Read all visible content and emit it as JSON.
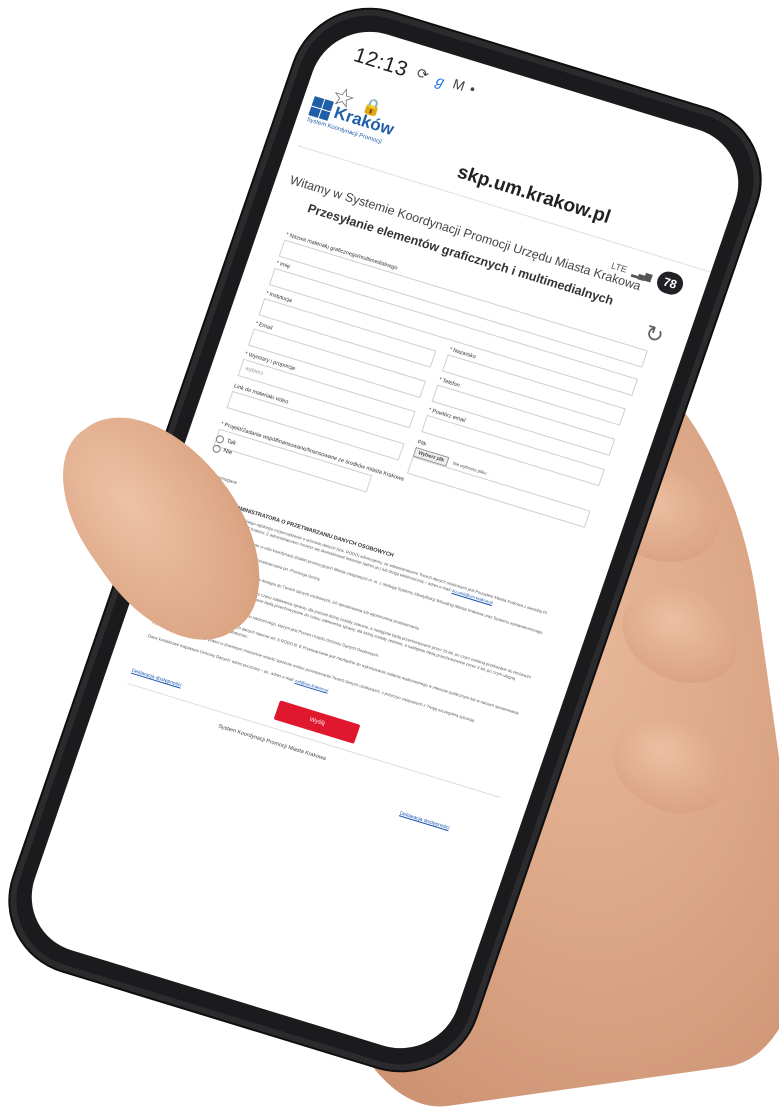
{
  "status": {
    "time": "12:13",
    "network": "LTE",
    "battery": "78"
  },
  "browser": {
    "url": "skp.um.krakow.pl"
  },
  "logo": {
    "name": "Kraków",
    "subtitle": "System Koordynacji Promocji"
  },
  "page": {
    "welcome": "Witamy w Systemie Koordynacji Promocji Urzędu Miasta Krakowa",
    "heading": "Przesyłanie elementów graficznych i multimedialnych"
  },
  "form": {
    "material_name_label": "* Nazwa materiału graficznego/multimedialnego",
    "first_name_label": "* Imię",
    "last_name_label": "* Nazwisko",
    "institution_label": "* Instytucja",
    "email_label": "* Email",
    "phone_label": "* Telefon",
    "dimensions_label": "* Wymiary i proporcje",
    "dimensions_placeholder": "wybierz",
    "repeat_email_label": "* Powtórz email",
    "video_link_label": "Link do materiału video",
    "file_label": "Plik",
    "file_button": "Wybierz plik",
    "file_status": "Nie wybrano pliku",
    "project_label": "* Projekt/Zadanie współfinansowane/finansowane ze środków miasta Krakowa",
    "option_yes": "Tak",
    "option_no": "Nie",
    "required_note": "* pole wymagane",
    "submit_label": "Wyślij"
  },
  "info": {
    "title": "INFORMACJA ADMINISTRATORA O PRZETWARZANIU DANYCH OSOBOWYCH",
    "p1": "Zgodnie z art. 13 ust. 1 i 2 unijnego ogólnego rozporządzenia o ochronie danych (tzw. RODO) informujemy, że administratorem Twoich danych osobowych jest Prezydent Miasta Krakowa z siedzibą Pl. Wszystkich Świętych 3-4, 31-004 Kraków. Z administratorem możesz się skontaktować listownie (adres jw.) lub drogą elektroniczną – adres e-mail: ",
    "p1_email": "ko.umk@um.krakow.pl",
    "p2": "Twoje dane osobowe będą przetwarzane w celu koordynacji działań promocyjnych Miasta związanych m. in. z obsługą Systemu Identyfikacji Wizualnej Miasta Krakowa oraz Systemu wystawienniczego.",
    "p3": "Twoje dane są objęte rejestrem czynności przetwarzania pn. Promocja Gminy.",
    "p4": "Informujemy, że:",
    "l1": "1. Masz prawo do żądania od administratora dostępu do Twoich danych osobowych, ich sprostowania lub ograniczenia przetwarzania.",
    "l2": "2. Twoje dane osobowe będą przetwarzane do czasu załatwienia sprawy, dla potrzeb której zostały zebrane, a następnie będą przechowywane przez 25 lat, po czym zostaną przekazane do Archiwum Narodowego w Krakowie, Kat. A – Dane osobowe będą przechowywane do czasu załatwienia sprawy, dla której zostały zebrane, a następnie będą przechowywane przez 5 lat, po czym ulegną zniszczeniu.",
    "l3": "3. Masz prawo do wniesienia skargi do organu nadzorczego, którym jest Prezes Urzędu Ochrony Danych Osobowych.",
    "l4": "4. Podstawą prawną przetwarzania Twoich danych stanowi art. 6 RODO lit. E Przetwarzanie jest niezbędne do wykonywania zadania realizowanego w interesie publicznym lub w ramach sprawowania władzy publicznej powierzonej administratorowi.",
    "p5": "Ponadto informujemy, że masz prawo w dowolnym momencie wnieść sprzeciw wobec przetwarzania Twoich danych osobowych, z przyczyn związanych z Twoją szczególną sytuacją.",
    "p6": "Dane kontaktowe Inspektora Ochrony Danych: adres pocztowy – jw., adres e-mail: ",
    "p6_email": "iod@um.krakow.pl"
  },
  "footer": {
    "accessibility_link": "Deklaracja dostępności",
    "text": "System Koordynacji Promocji Miasta Krakowa"
  }
}
